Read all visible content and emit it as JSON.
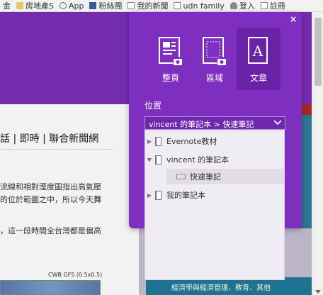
{
  "bookmarks_bar": [
    {
      "label": "金",
      "icon": "folder-icon"
    },
    {
      "label": "房地產S",
      "icon": "folder-icon"
    },
    {
      "label": "App",
      "icon": "apps-icon"
    },
    {
      "label": "粉絲團",
      "icon": "facebook-icon"
    },
    {
      "label": "我的新聞",
      "icon": "page-icon"
    },
    {
      "label": "udn family",
      "icon": "page-icon"
    },
    {
      "label": "登入",
      "icon": "person-icon"
    },
    {
      "label": "註冊",
      "icon": "page-icon"
    }
  ],
  "page": {
    "breadcrumb": "話 | 即時 | 聯合新聞網",
    "paragraph_1a": "流線和相對溼度圖指出高氣壓",
    "paragraph_1b": "的位於範圍之中，所以今天舞",
    "paragraph_2": "，這一段時間全台灣都是偏高",
    "chart_caption": "CWB GFS (0.5x0.5)",
    "right_ad_text": "經濟學與經濟管理、教育、其他"
  },
  "clipper": {
    "close_label": "×",
    "modes": [
      {
        "label": "整頁",
        "icon": "full-page-camera-icon",
        "selected": false
      },
      {
        "label": "區域",
        "icon": "region-camera-icon",
        "selected": false
      },
      {
        "label": "文章",
        "icon": "article-icon",
        "selected": true
      }
    ],
    "location_label": "位置",
    "selected_location": "vincent 的筆記本 > 快速筆記",
    "notebooks": [
      {
        "label": "Evernote教材",
        "expanded": false
      },
      {
        "label": "vincent 的筆記本",
        "expanded": true
      },
      {
        "label": "快速筆記",
        "child": true,
        "selected": true
      },
      {
        "label": "我的筆記本",
        "expanded": false
      }
    ]
  },
  "colors": {
    "accent": "#7f2fc0",
    "accent_dark": "#6a22a6",
    "dropdown_bg": "#f0ecf3"
  }
}
